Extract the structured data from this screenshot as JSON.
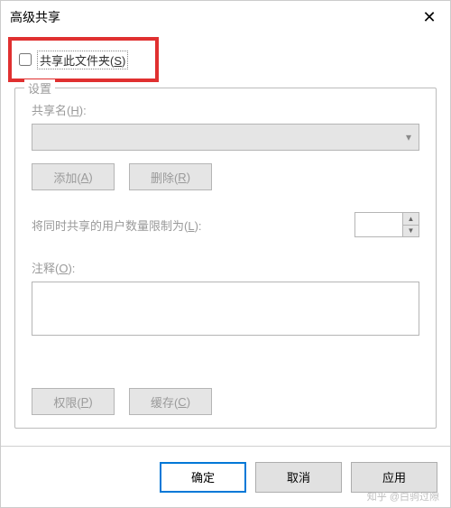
{
  "titlebar": {
    "title": "高级共享",
    "close": "✕"
  },
  "shareCheckbox": {
    "label": "共享此文件夹(S)"
  },
  "group": {
    "title": "设置",
    "shareName": {
      "label": "共享名(H):"
    },
    "addBtn": "添加(A)",
    "removeBtn": "删除(R)",
    "limitLabel": "将同时共享的用户数量限制为(L):",
    "commentLabel": "注释(O):",
    "permBtn": "权限(P)",
    "cacheBtn": "缓存(C)"
  },
  "buttons": {
    "ok": "确定",
    "cancel": "取消",
    "apply": "应用"
  },
  "watermark": "知乎 @白驹过隙"
}
